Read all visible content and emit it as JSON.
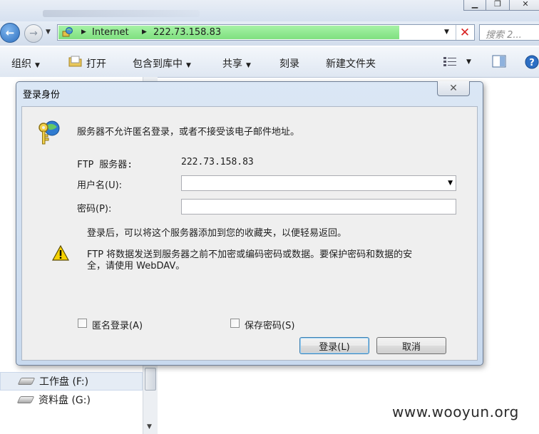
{
  "address_bar": {
    "segments": [
      "Internet",
      "222.73.158.83"
    ],
    "search_placeholder": "搜索 2..."
  },
  "toolbar": {
    "organize": "组织",
    "open": "打开",
    "include_in_library": "包含到库中",
    "share": "共享",
    "burn": "刻录",
    "new_folder": "新建文件夹"
  },
  "nav_pane": {
    "drives": [
      {
        "label": "工作盘 (F:)",
        "selected": true
      },
      {
        "label": "资料盘 (G:)",
        "selected": false
      }
    ]
  },
  "dialog": {
    "title": "登录身份",
    "message": "服务器不允许匿名登录，或者不接受该电子邮件地址。",
    "ftp_server_label": "FTP 服务器:",
    "ftp_server_value": "222.73.158.83",
    "username_label": "用户名(U):",
    "username_value": "",
    "password_label": "密码(P):",
    "password_value": "",
    "info_text": "登录后，可以将这个服务器添加到您的收藏夹，以便轻易返回。",
    "warning_line1": "FTP 将数据发送到服务器之前不加密或编码密码或数据。要保护密码和数据的安",
    "warning_line2": "全，请使用 WebDAV。",
    "anonymous_label": "匿名登录(A)",
    "anonymous_checked": false,
    "save_password_label": "保存密码(S)",
    "save_password_checked": false,
    "login_button": "登录(L)",
    "cancel_button": "取消"
  },
  "watermark": "www.wooyun.org",
  "colors": {
    "address_progress": "#8fe88f",
    "dialog_frame": "#c8d9ee",
    "dialog_body": "#efefef",
    "stop_icon": "#d82020"
  }
}
